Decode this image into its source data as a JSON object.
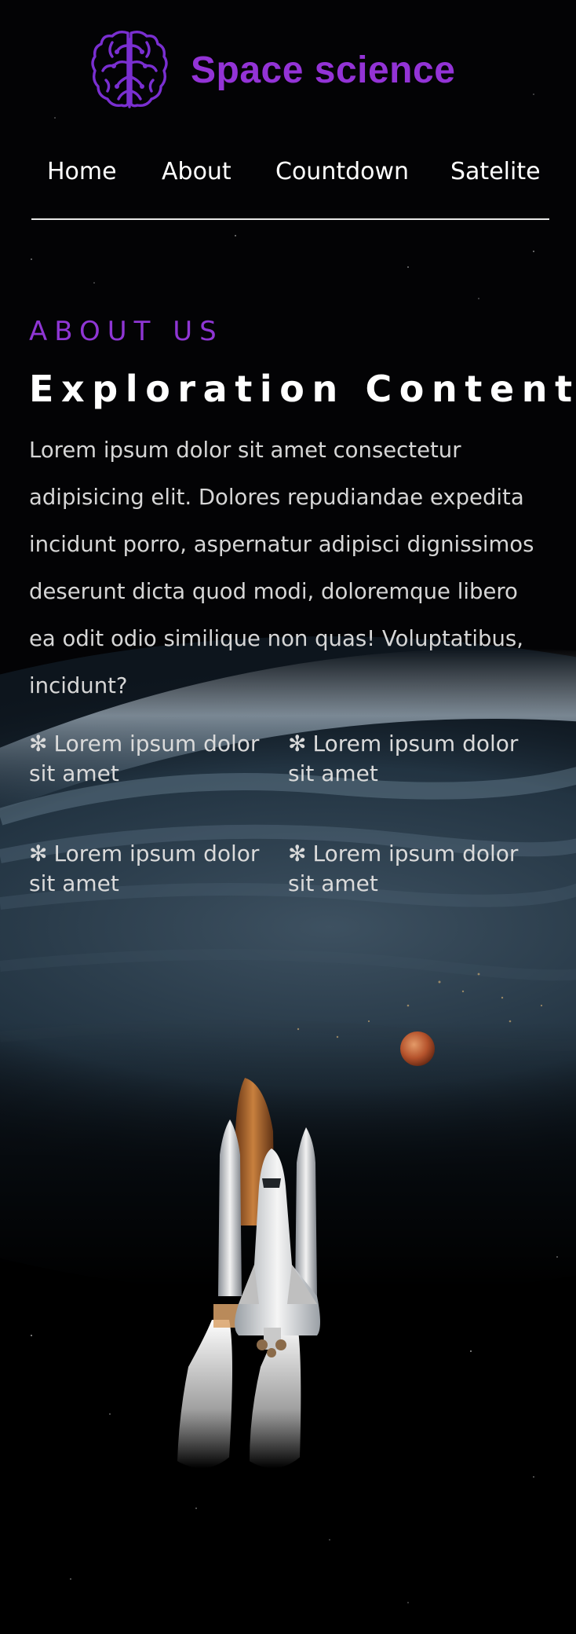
{
  "brand": {
    "name": "Space science",
    "icon": "brain-icon",
    "accent": "#9333d6"
  },
  "nav": {
    "items": [
      {
        "label": "Home"
      },
      {
        "label": "About"
      },
      {
        "label": "Countdown"
      },
      {
        "label": "Satelite"
      }
    ]
  },
  "about": {
    "eyebrow": "ABOUT US",
    "heading": "Exploration Content",
    "body": "Lorem ipsum dolor sit amet consectetur adipisicing elit. Dolores repudiandae expedita incidunt porro, aspernatur adipisci dignissimos deserunt dicta quod modi, doloremque libero ea odit odio similique non quas! Voluptatibus, incidunt?",
    "features": [
      {
        "icon": "asterisk-icon",
        "label": "Lorem ipsum dolor sit amet"
      },
      {
        "icon": "asterisk-icon",
        "label": "Lorem ipsum dolor sit amet"
      },
      {
        "icon": "asterisk-icon",
        "label": "Lorem ipsum dolor sit amet"
      },
      {
        "icon": "asterisk-icon",
        "label": "Lorem ipsum dolor sit amet"
      }
    ]
  },
  "hero": {
    "images": [
      "earth-horizon",
      "mars-planet",
      "space-shuttle"
    ]
  }
}
